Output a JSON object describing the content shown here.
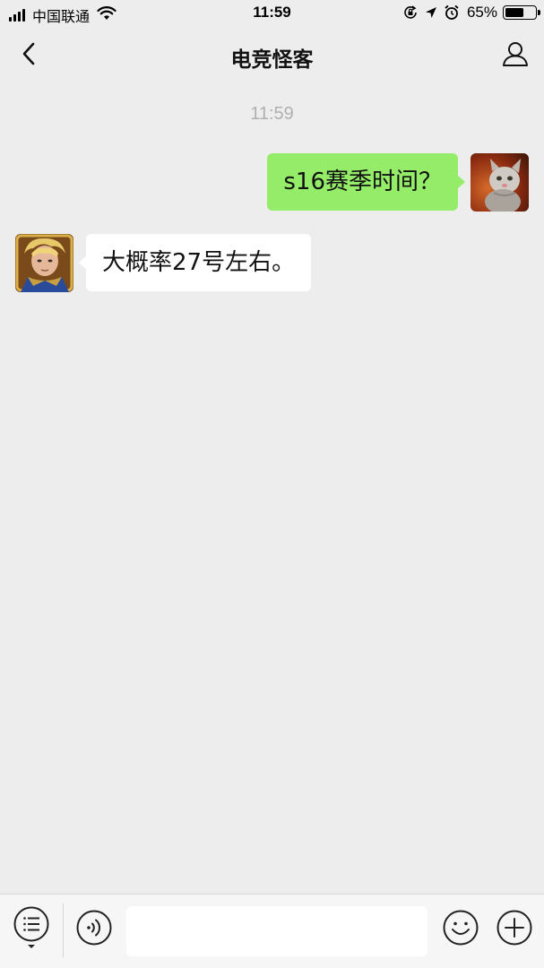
{
  "status_bar": {
    "carrier": "中国联通",
    "time": "11:59",
    "battery_percent": "65%",
    "battery_level": 0.65,
    "icons": [
      "signal-icon",
      "wifi-icon",
      "rotation-lock-icon",
      "location-icon",
      "alarm-icon",
      "battery-icon"
    ]
  },
  "nav": {
    "title": "电竞怪客",
    "back_icon": "chevron-left-icon",
    "profile_icon": "person-icon"
  },
  "chat": {
    "timestamp": "11:59",
    "messages": [
      {
        "side": "right",
        "text": "s16赛季时间？",
        "bubble_color": "#95ec69",
        "avatar": "cat-avatar"
      },
      {
        "side": "left",
        "text": "大概率27号左右。",
        "bubble_color": "#ffffff",
        "avatar": "hero-avatar"
      }
    ]
  },
  "input_bar": {
    "text_value": "",
    "icons": [
      "menu-list-icon",
      "voice-icon",
      "emoji-icon",
      "plus-icon"
    ]
  },
  "colors": {
    "background": "#ededed",
    "sent_bubble": "#95ec69",
    "received_bubble": "#ffffff",
    "timestamp": "#b0b0b0"
  }
}
